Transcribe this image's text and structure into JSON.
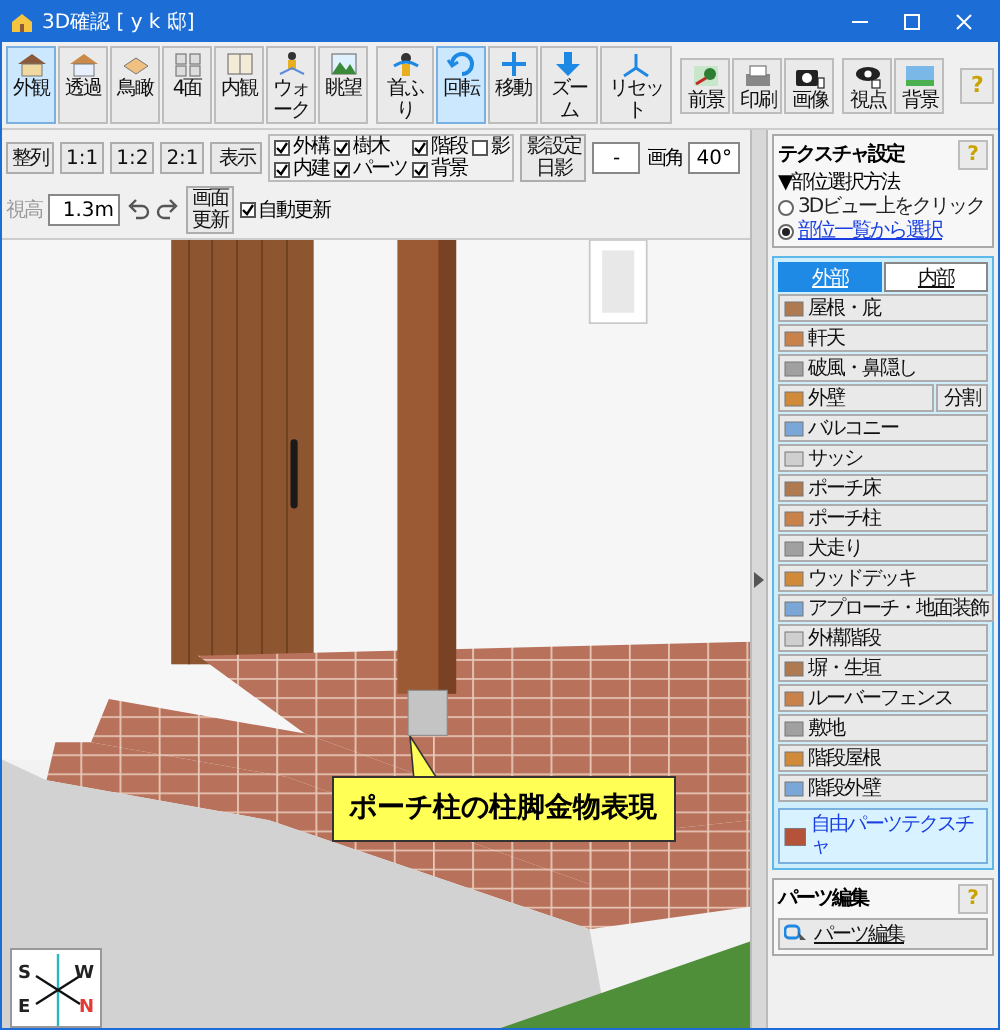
{
  "window": {
    "title": "3D確認 [ y k 邸]"
  },
  "toolbar": [
    {
      "label": "外観",
      "kind": "exterior",
      "selected": true
    },
    {
      "label": "透過",
      "kind": "transparent",
      "selected": false
    },
    {
      "label": "鳥瞰",
      "kind": "bird",
      "selected": false
    },
    {
      "label": "4面",
      "kind": "four",
      "selected": false
    },
    {
      "label": "内観",
      "kind": "interior",
      "selected": false
    },
    {
      "label": "ウォーク",
      "kind": "walk",
      "selected": false
    },
    {
      "label": "眺望",
      "kind": "view",
      "selected": false
    },
    {
      "label": "首ふり",
      "kind": "swing",
      "selected": false
    },
    {
      "label": "回転",
      "kind": "rotate",
      "selected": true
    },
    {
      "label": "移動",
      "kind": "move",
      "selected": false
    },
    {
      "label": "ズーム",
      "kind": "zoom",
      "selected": false
    },
    {
      "label": "リセット",
      "kind": "reset",
      "selected": false
    },
    {
      "label": "前景",
      "kind": "foreground",
      "selected": false
    },
    {
      "label": "印刷",
      "kind": "print",
      "selected": false
    },
    {
      "label": "画像",
      "kind": "image",
      "selected": false
    },
    {
      "label": "視点",
      "kind": "viewpoint",
      "selected": false
    },
    {
      "label": "背景",
      "kind": "background",
      "selected": false
    }
  ],
  "help": "?",
  "view_bar": {
    "align_label": "整列",
    "ratios": [
      "1:1",
      "1:2",
      "2:1"
    ],
    "display_button": "表示",
    "toggles": [
      {
        "label": "外構",
        "checked": true
      },
      {
        "label": "樹木",
        "checked": true
      },
      {
        "label": "階段",
        "checked": true
      },
      {
        "label": "影",
        "checked": false
      },
      {
        "label": "内建",
        "checked": true
      },
      {
        "label": "パーツ",
        "checked": true
      },
      {
        "label": "背景",
        "checked": true
      }
    ],
    "shadow_button": [
      "影設定",
      "日影"
    ],
    "shadow_field": "-",
    "angle_label": "画角",
    "angle_value": "40°",
    "height_label": "視高",
    "height_disabled": true,
    "height_value": "1.3m",
    "refresh_button": [
      "画面",
      "更新"
    ],
    "auto_update": {
      "label": "自動更新",
      "checked": true
    }
  },
  "scene": {
    "callout": "ポーチ柱の柱脚金物表現",
    "compass": [
      "S",
      "W",
      "E",
      "N"
    ]
  },
  "texture_panel": {
    "title": "テクスチャ設定",
    "help": "?",
    "method_label": "▼部位選択方法",
    "methods": [
      {
        "label": "3Dビュー上をクリック",
        "selected": false
      },
      {
        "label": "部位一覧から選択",
        "selected": true
      }
    ],
    "tabs": [
      {
        "label": "外部",
        "selected": true
      },
      {
        "label": "内部",
        "selected": false
      }
    ],
    "parts": [
      {
        "label": "屋根・庇"
      },
      {
        "label": "軒天"
      },
      {
        "label": "破風・鼻隠し"
      },
      {
        "label": "外壁",
        "extra": "分割"
      },
      {
        "label": "バルコニー"
      },
      {
        "label": "サッシ"
      },
      {
        "label": "ポーチ床"
      },
      {
        "label": "ポーチ柱"
      },
      {
        "label": "犬走り"
      },
      {
        "label": "ウッドデッキ"
      },
      {
        "label": "アプローチ・地面装飾"
      },
      {
        "label": "外構階段"
      },
      {
        "label": "塀・生垣"
      },
      {
        "label": "ルーバーフェンス"
      },
      {
        "label": "敷地"
      },
      {
        "label": "階段屋根"
      },
      {
        "label": "階段外壁"
      }
    ],
    "free_parts": "自由パーツテクスチャ"
  },
  "parts_edit": {
    "title": "パーツ編集",
    "help": "?",
    "button": "パーツ編集"
  }
}
